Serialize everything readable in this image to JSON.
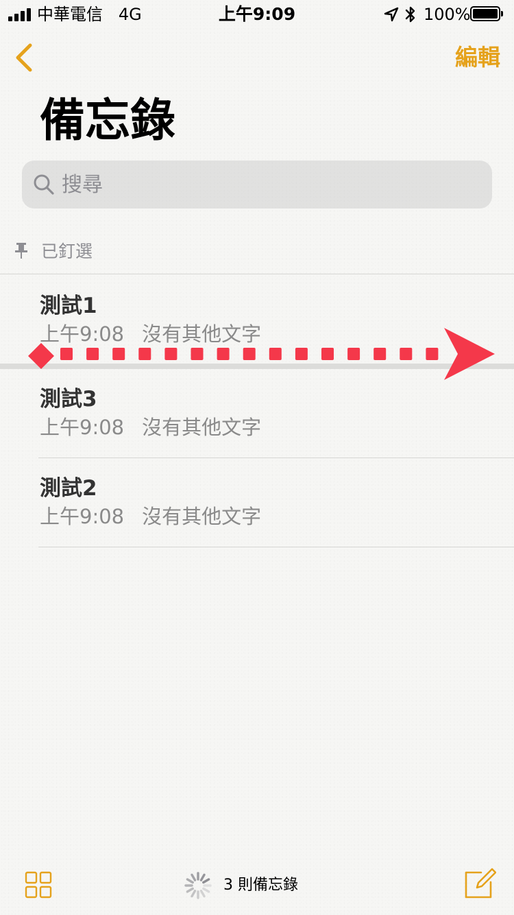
{
  "colors": {
    "accent": "#e5a21c",
    "annotation": "#f4384a"
  },
  "status_bar": {
    "carrier": "中華電信",
    "network": "4G",
    "time": "上午9:09",
    "battery": "100%",
    "icons": [
      "signal-icon",
      "location-icon",
      "bluetooth-icon",
      "battery-icon"
    ]
  },
  "nav": {
    "back_icon": "chevron-left-icon",
    "edit_label": "編輯"
  },
  "title": "備忘錄",
  "search": {
    "placeholder": "搜尋",
    "value": ""
  },
  "pinned_section": {
    "icon": "pin-icon",
    "label": "已釘選"
  },
  "pinned_notes": [
    {
      "title": "測試1",
      "time": "上午9:08",
      "preview": "沒有其他文字"
    }
  ],
  "notes": [
    {
      "title": "測試3",
      "time": "上午9:08",
      "preview": "沒有其他文字"
    },
    {
      "title": "測試2",
      "time": "上午9:08",
      "preview": "沒有其他文字"
    }
  ],
  "annotation": {
    "type": "swipe-right-arrow"
  },
  "toolbar": {
    "count_label": "3 則備忘錄",
    "left_icon": "gallery-grid-icon",
    "right_icon": "compose-icon"
  }
}
